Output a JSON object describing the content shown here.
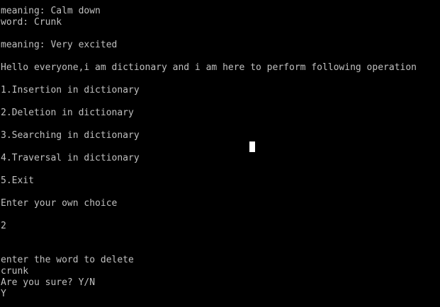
{
  "colors": {
    "background": "#000000",
    "text": "#c0c0c0",
    "cursor": "#ffffff"
  },
  "console": {
    "lines": [
      "meaning: Calm down",
      "word: Crunk",
      "meaning: Very excited",
      "Hello everyone,i am dictionary and i am here to perform following operation",
      "1.Insertion in dictionary",
      "2.Deletion in dictionary",
      "3.Searching in dictionary",
      "4.Traversal in dictionary",
      "5.Exit",
      "Enter your own choice",
      "2",
      "enter the word to delete",
      "crunk",
      "Are you sure? Y/N",
      "Y"
    ]
  }
}
